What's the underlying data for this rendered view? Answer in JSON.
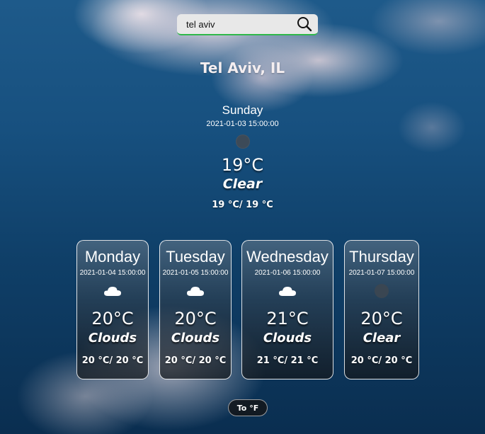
{
  "search": {
    "value": "tel aviv",
    "placeholder": ""
  },
  "location": {
    "city": "Tel Aviv, IL"
  },
  "current": {
    "day": "Sunday",
    "datetime": "2021-01-03 15:00:00",
    "icon": "moon-icon",
    "temp": "19°C",
    "description": "Clear",
    "range": "19 °C/ 19 °C"
  },
  "forecast": [
    {
      "day": "Monday",
      "datetime": "2021-01-04 15:00:00",
      "icon": "cloud-icon",
      "temp": "20°C",
      "description": "Clouds",
      "range": "20 °C/ 20 °C"
    },
    {
      "day": "Tuesday",
      "datetime": "2021-01-05 15:00:00",
      "icon": "cloud-icon",
      "temp": "20°C",
      "description": "Clouds",
      "range": "20 °C/ 20 °C"
    },
    {
      "day": "Wednesday",
      "datetime": "2021-01-06 15:00:00",
      "icon": "cloud-icon",
      "temp": "21°C",
      "description": "Clouds",
      "range": "21 °C/ 21 °C"
    },
    {
      "day": "Thursday",
      "datetime": "2021-01-07 15:00:00",
      "icon": "moon-icon",
      "temp": "20°C",
      "description": "Clear",
      "range": "20 °C/ 20 °C"
    }
  ],
  "toggle": {
    "label": "To °F"
  },
  "colors": {
    "search_accent": "#2fb84a",
    "sky_top": "#1e5a8a",
    "sky_bottom": "#0a2e50"
  }
}
